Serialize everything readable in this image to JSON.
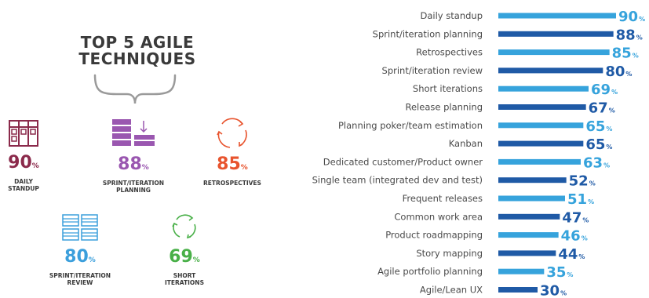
{
  "colors": {
    "dark_blue": "#1f5aa6",
    "light_blue": "#36a3dc",
    "maroon": "#8b2a4b",
    "purple": "#9a57b0",
    "orange": "#e8542e",
    "sky": "#3b9fdc",
    "green": "#49b048"
  },
  "left": {
    "title": "TOP 5 AGILE\nTECHNIQUES",
    "top_techniques": [
      {
        "value": "90",
        "unit": "%",
        "label": "DAILY\nSTANDUP",
        "icon": "kanban-board-icon",
        "color": "#8b2a4b"
      },
      {
        "value": "88",
        "unit": "%",
        "label": "SPRINT/ITERATION\nPLANNING",
        "icon": "backlog-stack-icon",
        "color": "#9a57b0"
      },
      {
        "value": "85",
        "unit": "%",
        "label": "RETROSPECTIVES",
        "icon": "retrospective-cycle-icon",
        "color": "#e8542e"
      },
      {
        "value": "80",
        "unit": "%",
        "label": "SPRINT/ITERATION\nREVIEW",
        "icon": "review-documents-icon",
        "color": "#3b9fdc"
      },
      {
        "value": "69",
        "unit": "%",
        "label": "SHORT\nITERATIONS",
        "icon": "short-cycle-icon",
        "color": "#49b048"
      }
    ]
  },
  "chart_data": {
    "type": "bar",
    "orientation": "horizontal",
    "unit": "%",
    "categories": [
      "Daily standup",
      "Sprint/iteration planning",
      "Retrospectives",
      "Sprint/iteration review",
      "Short iterations",
      "Release planning",
      "Planning poker/team estimation",
      "Kanban",
      "Dedicated customer/Product owner",
      "Single team (integrated dev and test)",
      "Frequent releases",
      "Common work area",
      "Product roadmapping",
      "Story mapping",
      "Agile portfolio planning",
      "Agile/Lean UX"
    ],
    "values": [
      90,
      88,
      85,
      80,
      69,
      67,
      65,
      65,
      63,
      52,
      51,
      47,
      46,
      44,
      35,
      30
    ],
    "bar_colors": [
      "#36a3dc",
      "#1f5aa6",
      "#36a3dc",
      "#1f5aa6",
      "#36a3dc",
      "#1f5aa6",
      "#36a3dc",
      "#1f5aa6",
      "#36a3dc",
      "#1f5aa6",
      "#36a3dc",
      "#1f5aa6",
      "#36a3dc",
      "#1f5aa6",
      "#36a3dc",
      "#1f5aa6"
    ],
    "xlim": [
      0,
      90
    ]
  }
}
